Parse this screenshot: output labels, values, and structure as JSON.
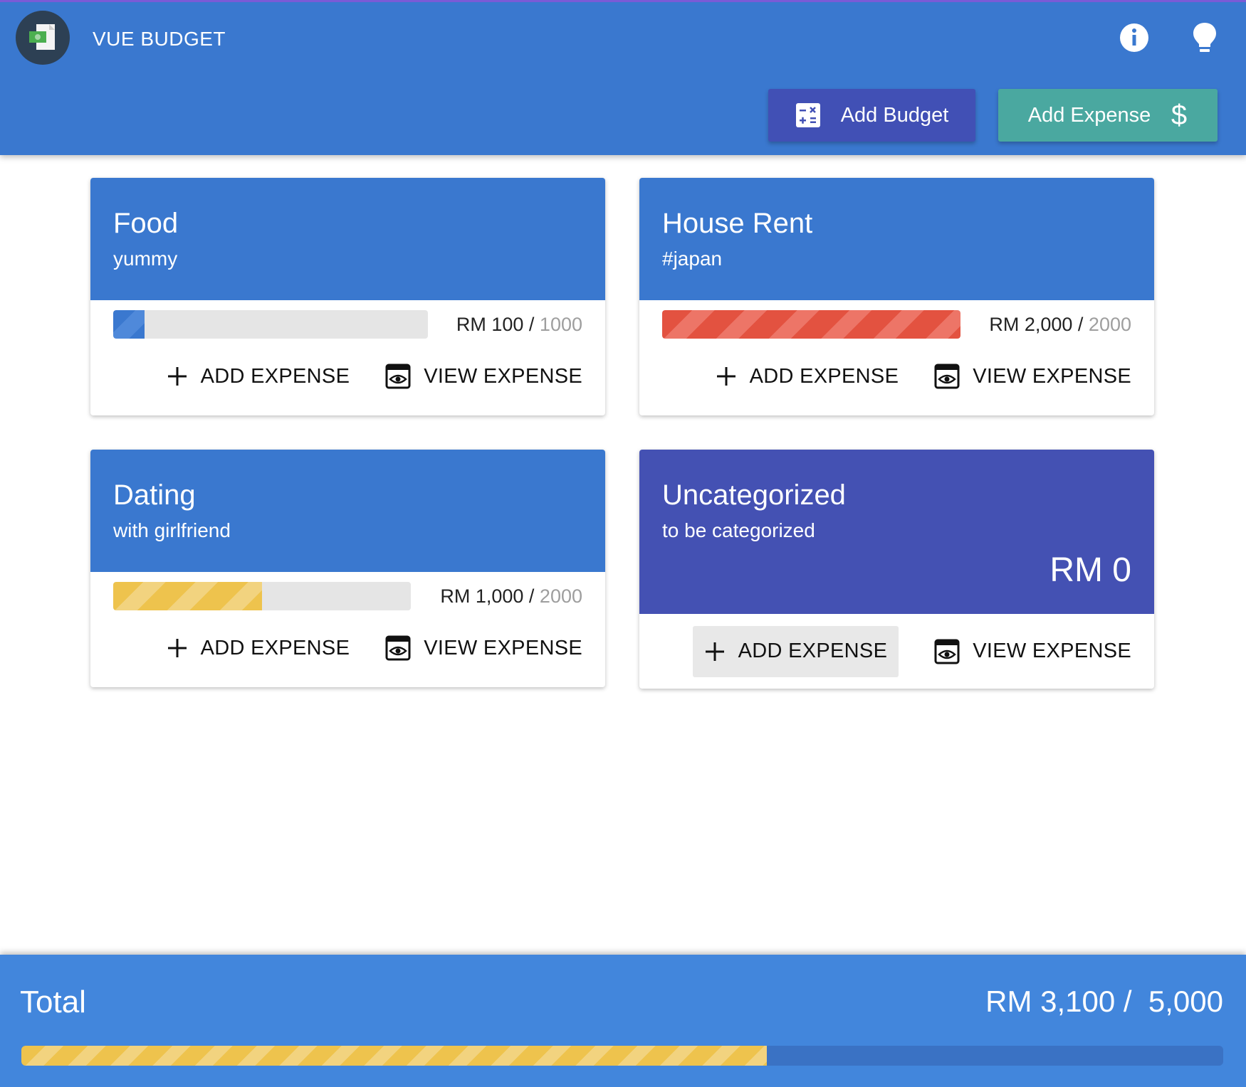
{
  "header": {
    "app_title": "VUE BUDGET",
    "add_budget_label": "Add Budget",
    "add_expense_label": "Add Expense"
  },
  "action_labels": {
    "add_expense": "ADD EXPENSE",
    "view_expense": "VIEW EXPENSE"
  },
  "budgets": [
    {
      "title": "Food",
      "subtitle": "yummy",
      "spent": "RM 100",
      "limit": "1000",
      "progress": 0.1,
      "bar_color": "blue"
    },
    {
      "title": "House Rent",
      "subtitle": "#japan",
      "spent": "RM 2,000",
      "limit": "2000",
      "progress": 1.0,
      "bar_color": "red"
    },
    {
      "title": "Dating",
      "subtitle": "with girlfriend",
      "spent": "RM 1,000",
      "limit": "2000",
      "progress": 0.5,
      "bar_color": "yellow"
    }
  ],
  "uncategorized": {
    "title": "Uncategorized",
    "subtitle": "to be categorized",
    "amount": "RM 0"
  },
  "total": {
    "label": "Total",
    "spent": "RM 3,100 /",
    "limit": "5,000",
    "progress": 0.62
  },
  "colors": {
    "primary": "#3a78cf",
    "indigo": "#4451b3",
    "teal": "#4aa8a0",
    "red": "#e35240",
    "yellow": "#eec34d"
  }
}
